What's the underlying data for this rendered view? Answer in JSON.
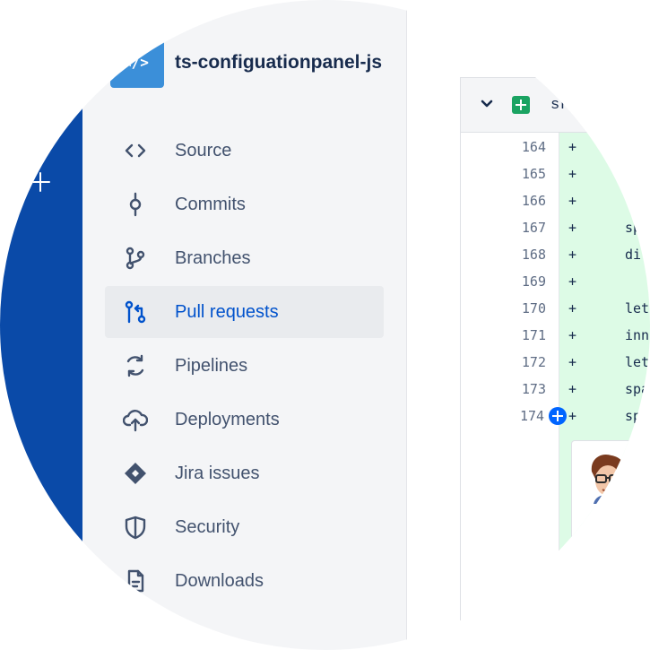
{
  "repo": {
    "name": "ts-configuationpanel-js",
    "logo_glyph": "</>"
  },
  "sidebar": {
    "items": [
      {
        "label": "Source",
        "icon": "code-icon",
        "active": false
      },
      {
        "label": "Commits",
        "icon": "commit-icon",
        "active": false
      },
      {
        "label": "Branches",
        "icon": "branch-icon",
        "active": false
      },
      {
        "label": "Pull requests",
        "icon": "pull-request-icon",
        "active": true
      },
      {
        "label": "Pipelines",
        "icon": "pipelines-icon",
        "active": false
      },
      {
        "label": "Deployments",
        "icon": "cloud-upload-icon",
        "active": false
      },
      {
        "label": "Jira issues",
        "icon": "jira-icon",
        "active": false
      },
      {
        "label": "Security",
        "icon": "shield-icon",
        "active": false
      },
      {
        "label": "Downloads",
        "icon": "download-file-icon",
        "active": false
      }
    ]
  },
  "diff": {
    "file_name": "sr",
    "lines": [
      {
        "number": "164",
        "sign": "+",
        "code": ""
      },
      {
        "number": "165",
        "sign": "+",
        "code": ""
      },
      {
        "number": "166",
        "sign": "+",
        "code": ""
      },
      {
        "number": "167",
        "sign": "+",
        "code": "sp"
      },
      {
        "number": "168",
        "sign": "+",
        "code": "di"
      },
      {
        "number": "169",
        "sign": "+",
        "code": ""
      },
      {
        "number": "170",
        "sign": "+",
        "code": "let"
      },
      {
        "number": "171",
        "sign": "+",
        "code": "inn"
      },
      {
        "number": "172",
        "sign": "+",
        "code": "let"
      },
      {
        "number": "173",
        "sign": "+",
        "code": "spa"
      },
      {
        "number": "174",
        "sign": "+",
        "code": "sp"
      }
    ]
  },
  "colors": {
    "global_nav": "#0a4aa8",
    "sidebar_bg": "#f4f5f7",
    "active_text": "#0052cc",
    "added_line_bg": "#ddfbe6",
    "add_badge": "#1aa362"
  }
}
